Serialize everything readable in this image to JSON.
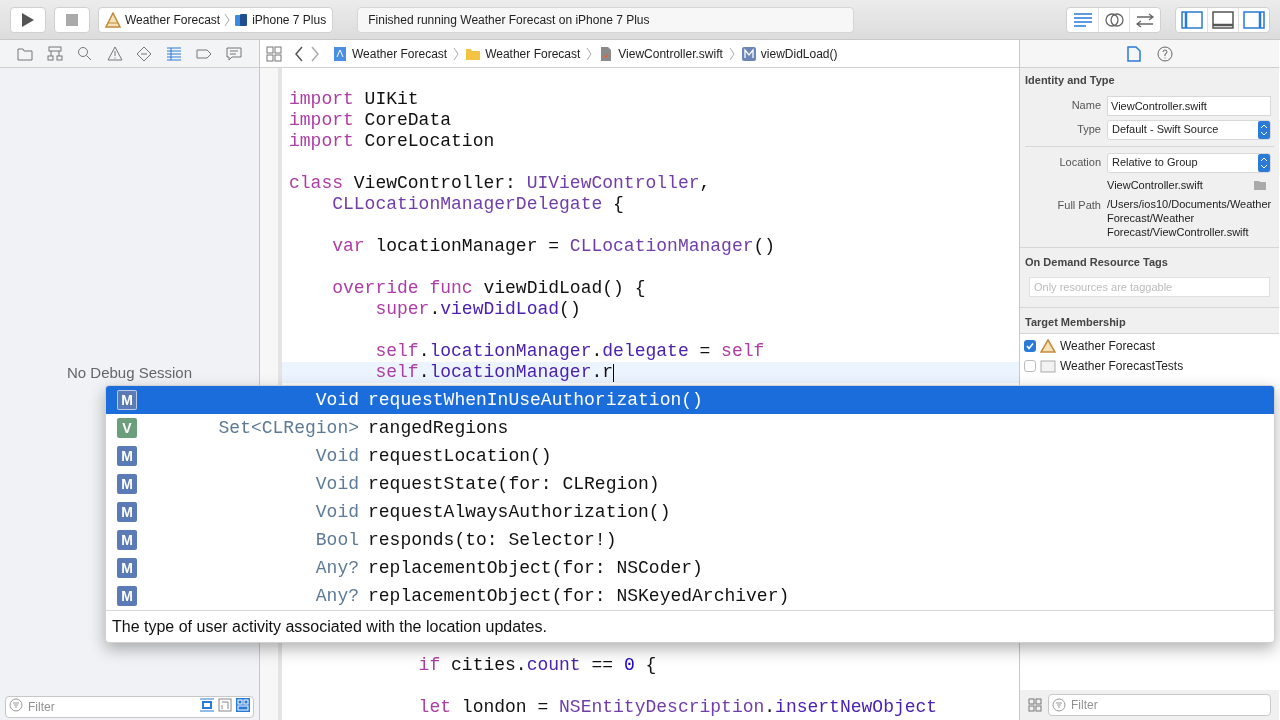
{
  "toolbar": {
    "scheme": "Weather Forecast",
    "device": "iPhone 7 Plus",
    "status": "Finished running Weather Forecast on iPhone 7 Plus",
    "editor_modes": [
      {
        "selected": true
      },
      {
        "selected": false
      },
      {
        "selected": false
      }
    ],
    "panels": [
      {
        "on": true
      },
      {
        "on": false
      },
      {
        "on": true
      }
    ]
  },
  "navigator": {
    "tabs": [
      {
        "selected": false
      },
      {
        "selected": false
      },
      {
        "selected": false
      },
      {
        "selected": false
      },
      {
        "selected": false
      },
      {
        "selected": true
      },
      {
        "selected": false
      },
      {
        "selected": false
      }
    ],
    "message": "No Debug Session",
    "filter": {
      "placeholder": "Filter"
    }
  },
  "jump_bar": [
    "Weather Forecast",
    "Weather Forecast",
    "ViewController.swift",
    "viewDidLoad()"
  ],
  "code_top": [
    {
      "tokens": [
        {
          "kind": "keyword",
          "text": "import"
        },
        {
          "kind": "plain",
          "text": " UIKit"
        }
      ]
    },
    {
      "tokens": [
        {
          "kind": "keyword",
          "text": "import"
        },
        {
          "kind": "plain",
          "text": " CoreData"
        }
      ]
    },
    {
      "tokens": [
        {
          "kind": "keyword",
          "text": "import"
        },
        {
          "kind": "plain",
          "text": " CoreLocation"
        }
      ]
    },
    {
      "blank_before": true,
      "tokens": [
        {
          "kind": "keyword",
          "text": "class"
        },
        {
          "kind": "plain",
          "text": " ViewController: "
        },
        {
          "kind": "type",
          "text": "UIViewController"
        },
        {
          "kind": "plain",
          "text": ","
        }
      ]
    },
    {
      "tokens": [
        {
          "kind": "type",
          "text": "    CLLocationManagerDelegate"
        },
        {
          "kind": "plain",
          "text": " {"
        }
      ]
    },
    {
      "blank_before": true,
      "tokens": [
        {
          "kind": "keyword",
          "text": "    var"
        },
        {
          "kind": "plain",
          "text": " locationManager = "
        },
        {
          "kind": "type",
          "text": "CLLocationManager"
        },
        {
          "kind": "plain",
          "text": "()"
        }
      ]
    },
    {
      "blank_before": true,
      "tokens": [
        {
          "kind": "keyword",
          "text": "    override func"
        },
        {
          "kind": "plain",
          "text": " viewDidLoad() {"
        }
      ]
    },
    {
      "tokens": [
        {
          "kind": "keyword",
          "text": "        super"
        },
        {
          "kind": "plain",
          "text": "."
        },
        {
          "kind": "member",
          "text": "viewDidLoad"
        },
        {
          "kind": "plain",
          "text": "()"
        }
      ]
    },
    {
      "blank_before": true,
      "tokens": [
        {
          "kind": "keyword",
          "text": "        self"
        },
        {
          "kind": "plain",
          "text": "."
        },
        {
          "kind": "member",
          "text": "locationManager"
        },
        {
          "kind": "plain",
          "text": "."
        },
        {
          "kind": "member",
          "text": "delegate"
        },
        {
          "kind": "plain",
          "text": " = "
        },
        {
          "kind": "keyword",
          "text": "self"
        }
      ]
    },
    {
      "current": true,
      "tokens": [
        {
          "kind": "keyword",
          "text": "        self"
        },
        {
          "kind": "plain",
          "text": "."
        },
        {
          "kind": "member",
          "text": "locationManager"
        },
        {
          "kind": "plain",
          "text": ".r"
        }
      ]
    }
  ],
  "code_bottom": [
    {
      "tokens": [
        {
          "kind": "keyword",
          "text": "            if"
        },
        {
          "kind": "plain",
          "text": " cities."
        },
        {
          "kind": "member",
          "text": "count"
        },
        {
          "kind": "plain",
          "text": " == "
        },
        {
          "kind": "number",
          "text": "0"
        },
        {
          "kind": "plain",
          "text": " {"
        }
      ]
    },
    {
      "blank_before": true,
      "tokens": [
        {
          "kind": "keyword",
          "text": "            let"
        },
        {
          "kind": "plain",
          "text": " london = "
        },
        {
          "kind": "type",
          "text": "NSEntityDescription"
        },
        {
          "kind": "plain",
          "text": "."
        },
        {
          "kind": "member",
          "text": "insertNewObject"
        }
      ]
    }
  ],
  "completions": [
    {
      "kind": "method",
      "badge": "M",
      "type": "Void",
      "name": "requestWhenInUseAuthorization()",
      "selected": true
    },
    {
      "kind": "variable",
      "badge": "V",
      "type": "Set<CLRegion>",
      "name": "rangedRegions",
      "selected": false
    },
    {
      "kind": "method",
      "badge": "M",
      "type": "Void",
      "name": "requestLocation()",
      "selected": false
    },
    {
      "kind": "method",
      "badge": "M",
      "type": "Void",
      "name": "requestState(for: CLRegion)",
      "selected": false
    },
    {
      "kind": "method",
      "badge": "M",
      "type": "Void",
      "name": "requestAlwaysAuthorization()",
      "selected": false
    },
    {
      "kind": "method",
      "badge": "M",
      "type": "Bool",
      "name": "responds(to: Selector!)",
      "selected": false
    },
    {
      "kind": "method",
      "badge": "M",
      "type": "Any?",
      "name": "replacementObject(for: NSCoder)",
      "selected": false
    },
    {
      "kind": "method",
      "badge": "M",
      "type": "Any?",
      "name": "replacementObject(for: NSKeyedArchiver)",
      "selected": false
    }
  ],
  "completion_description": "The type of user activity associated with the location updates.",
  "inspector": {
    "identity_title": "Identity and Type",
    "name_label": "Name",
    "name_value": "ViewController.swift",
    "type_label": "Type",
    "type_value": "Default - Swift Source",
    "location_label": "Location",
    "location_value": "Relative to Group",
    "location_file": "ViewController.swift",
    "full_path_label": "Full Path",
    "full_path": "/Users/ios10/Documents/Weather Forecast/Weather Forecast/ViewController.swift",
    "tags_title": "On Demand Resource Tags",
    "tags_placeholder": "Only resources are taggable",
    "membership_title": "Target Membership",
    "targets": [
      {
        "kind": "app",
        "label": "Weather Forecast",
        "checked": true
      },
      {
        "kind": "folder",
        "label": "Weather ForecastTests",
        "checked": false
      }
    ],
    "filter": {
      "placeholder": "Filter"
    }
  }
}
